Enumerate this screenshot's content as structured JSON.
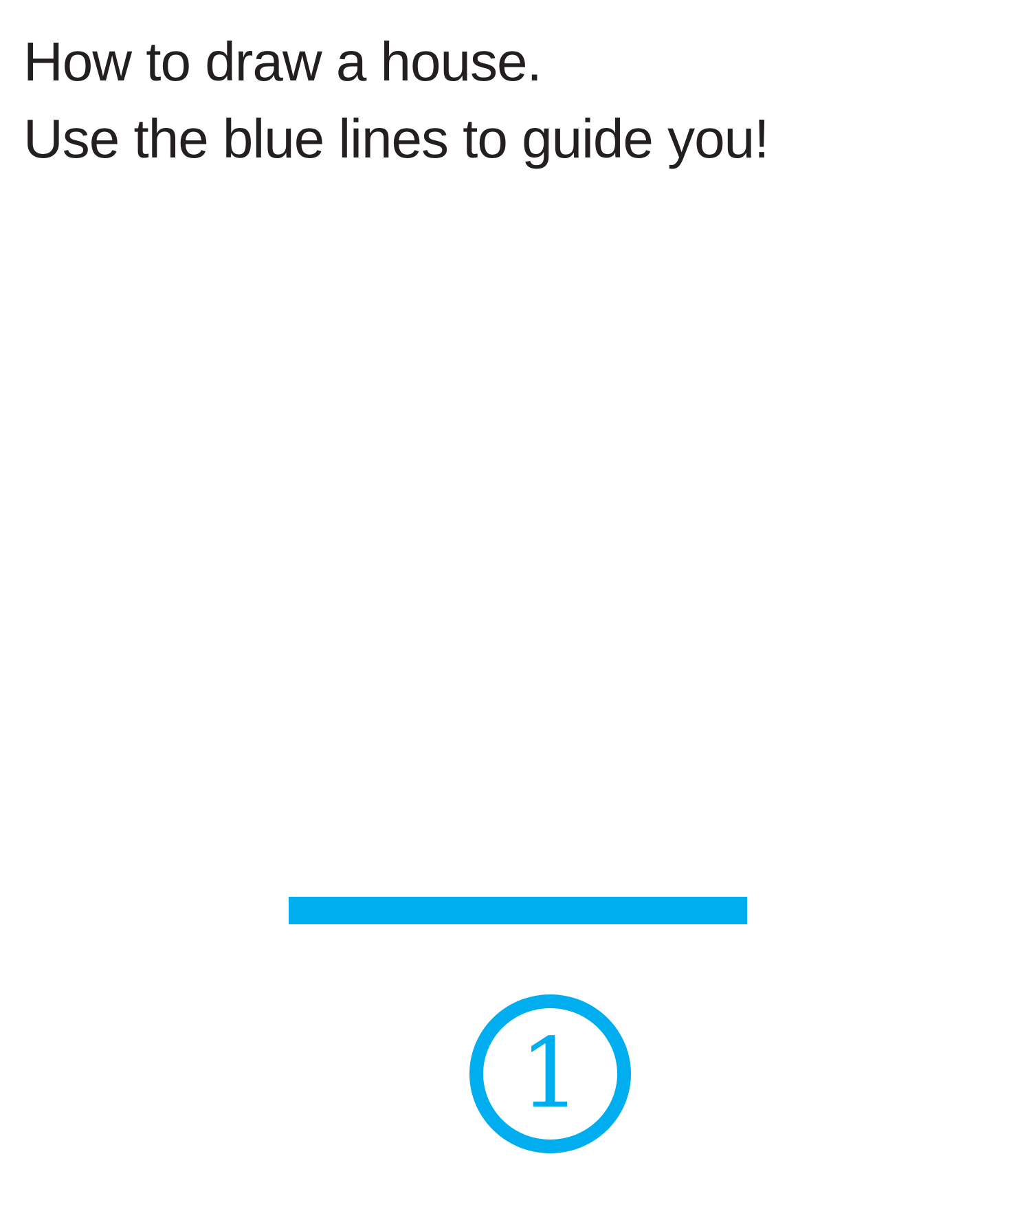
{
  "instructions": {
    "line1": "How to draw a house.",
    "line2": "Use the blue lines to guide you!"
  },
  "step": {
    "number": "1"
  },
  "colors": {
    "text": "#231f20",
    "accent": "#00aeef"
  }
}
